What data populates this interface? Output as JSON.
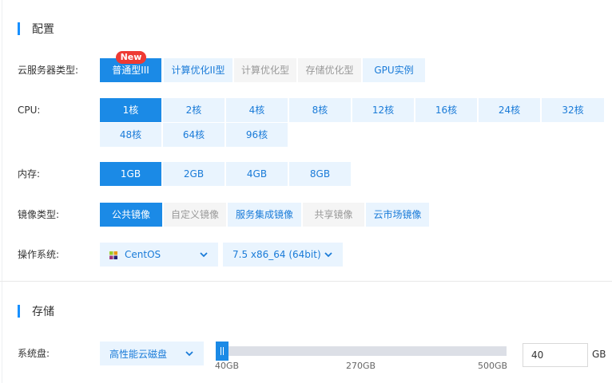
{
  "config": {
    "title": "配置",
    "instance_type": {
      "label": "云服务器类型:",
      "badge": "New",
      "options": [
        "普通型III",
        "计算优化II型",
        "计算优化型",
        "存储优化型",
        "GPU实例"
      ]
    },
    "cpu": {
      "label": "CPU:",
      "options": [
        "1核",
        "2核",
        "4核",
        "8核",
        "12核",
        "16核",
        "24核",
        "32核",
        "48核",
        "64核",
        "96核"
      ]
    },
    "memory": {
      "label": "内存:",
      "options": [
        "1GB",
        "2GB",
        "4GB",
        "8GB"
      ]
    },
    "image_type": {
      "label": "镜像类型:",
      "options": [
        "公共镜像",
        "自定义镜像",
        "服务集成镜像",
        "共享镜像",
        "云市场镜像"
      ]
    },
    "os": {
      "label": "操作系统:",
      "distro": "CentOS",
      "version": "7.5 x86_64 (64bit)"
    }
  },
  "storage": {
    "title": "存储",
    "system_disk": {
      "label": "系统盘:",
      "disk_type": "高性能云磁盘",
      "slider_ticks": [
        "40GB",
        "270GB",
        "500GB"
      ],
      "slider_min": 40,
      "slider_max": 500,
      "value": "40",
      "unit": "GB"
    }
  },
  "colors": {
    "accent": "#1b8ae6",
    "option_bg": "#e9f4fe",
    "badge": "#ee3a33"
  }
}
